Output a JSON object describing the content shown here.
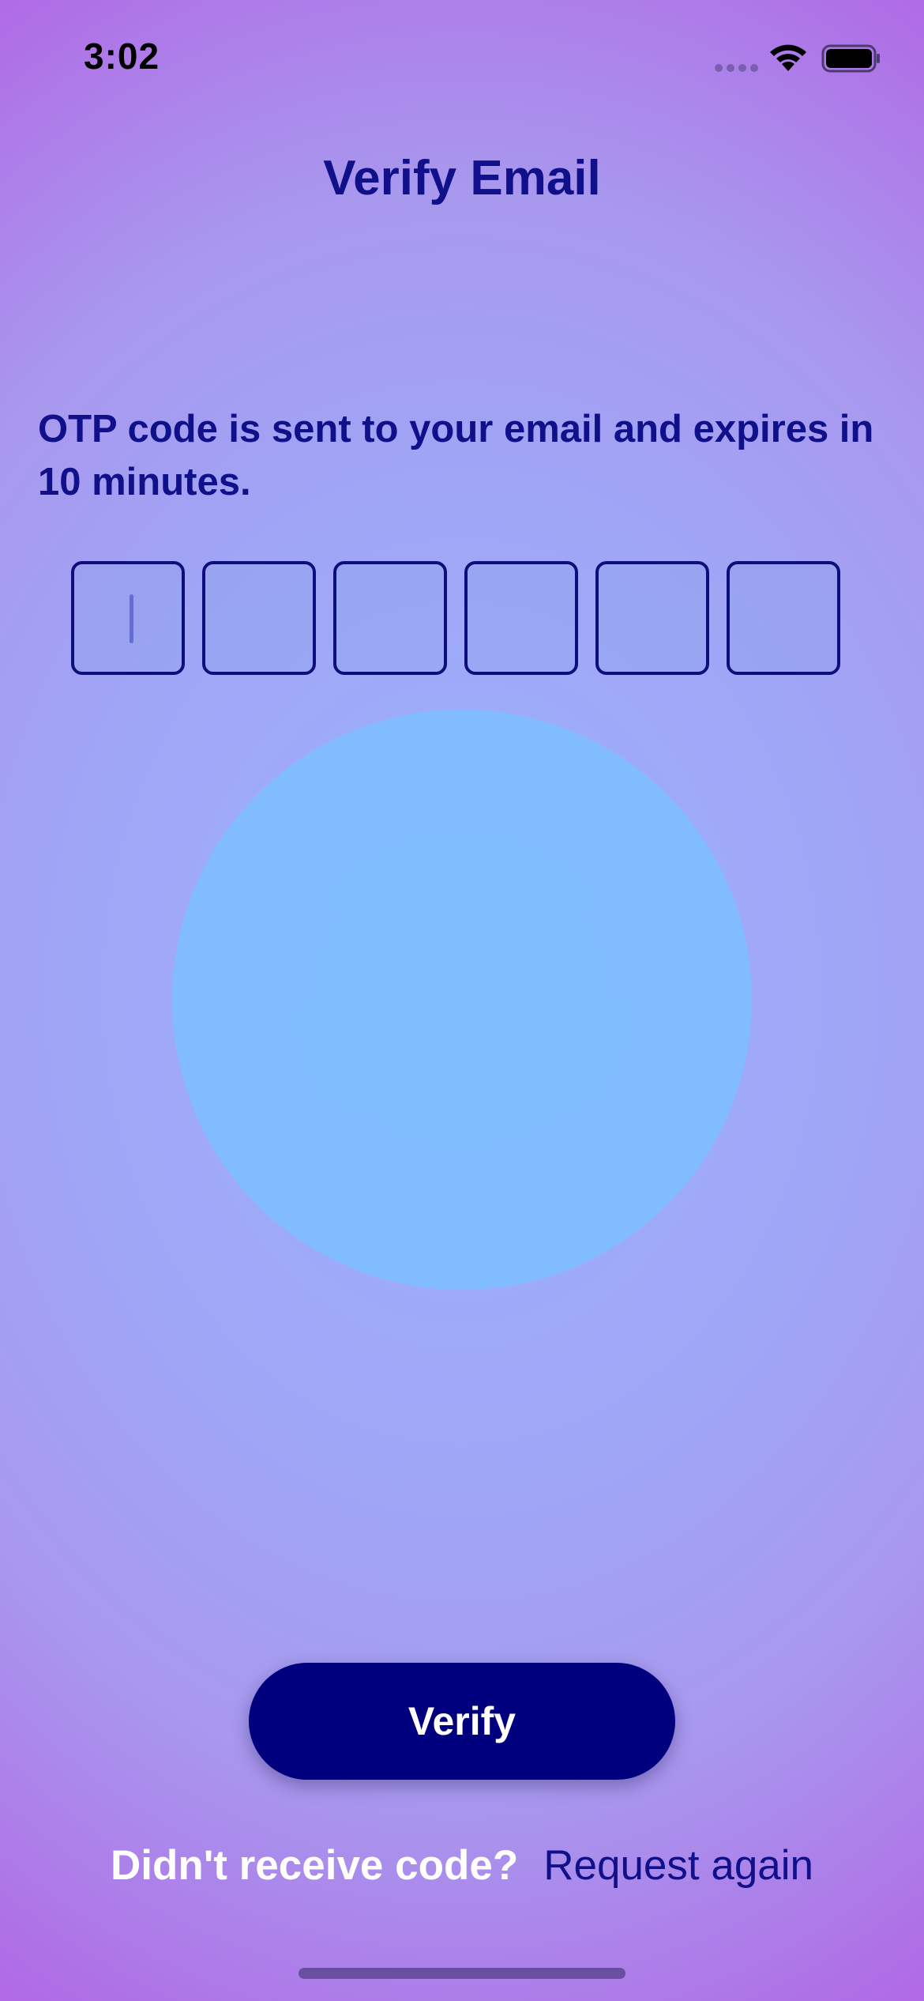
{
  "status_bar": {
    "time": "3:02",
    "icons": [
      "signal-dots-icon",
      "wifi-icon",
      "battery-icon"
    ]
  },
  "header": {
    "title": "Verify Email"
  },
  "main": {
    "instruction": "OTP code is sent to your email and expires in 10 minutes.",
    "otp_digits": [
      "",
      "",
      "",
      "",
      "",
      ""
    ]
  },
  "actions": {
    "verify_label": "Verify",
    "resend_prompt": "Didn't receive code?",
    "resend_link": "Request again"
  },
  "colors": {
    "primary": "#00007E",
    "title_text": "#10108A",
    "background_edge": "#B06BE5",
    "background_center": "#9CB3FD",
    "glow": "#80BCFF"
  }
}
